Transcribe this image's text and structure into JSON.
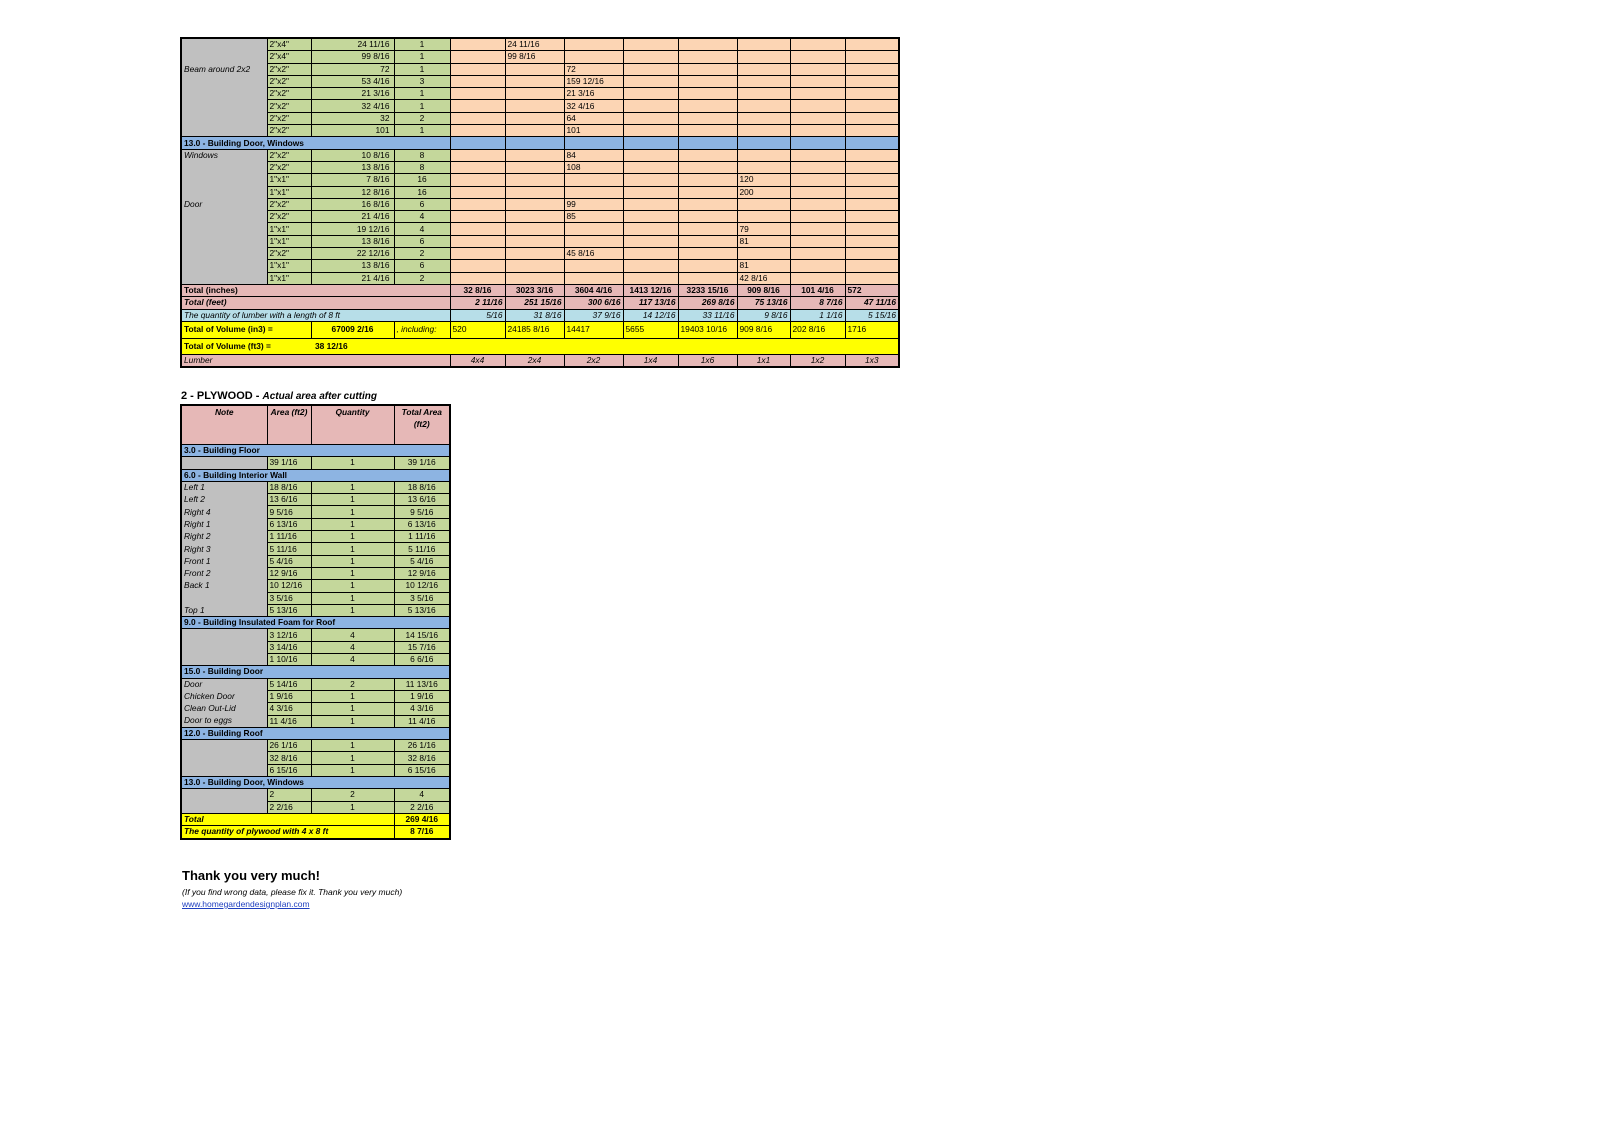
{
  "lumber": {
    "rows": [
      {
        "type": "item",
        "note": "",
        "size": "2\"x4\"",
        "len": "24 11/16",
        "qty": "1",
        "cols": [
          "",
          "24 11/16",
          "",
          "",
          "",
          "",
          "",
          ""
        ]
      },
      {
        "type": "item",
        "note": "",
        "size": "2\"x4\"",
        "len": "99  8/16",
        "qty": "1",
        "cols": [
          "",
          "99  8/16",
          "",
          "",
          "",
          "",
          "",
          ""
        ]
      },
      {
        "type": "item",
        "note": "Beam around 2x2",
        "size": "2\"x2\"",
        "len": "72",
        "qty": "1",
        "cols": [
          "",
          "",
          "72",
          "",
          "",
          "",
          "",
          ""
        ]
      },
      {
        "type": "item",
        "note": "",
        "size": "2\"x2\"",
        "len": "53  4/16",
        "qty": "3",
        "cols": [
          "",
          "",
          "159 12/16",
          "",
          "",
          "",
          "",
          ""
        ]
      },
      {
        "type": "item",
        "note": "",
        "size": "2\"x2\"",
        "len": "21  3/16",
        "qty": "1",
        "cols": [
          "",
          "",
          "21  3/16",
          "",
          "",
          "",
          "",
          ""
        ]
      },
      {
        "type": "item",
        "note": "",
        "size": "2\"x2\"",
        "len": "32  4/16",
        "qty": "1",
        "cols": [
          "",
          "",
          "32  4/16",
          "",
          "",
          "",
          "",
          ""
        ]
      },
      {
        "type": "item",
        "note": "",
        "size": "2\"x2\"",
        "len": "32",
        "qty": "2",
        "cols": [
          "",
          "",
          "64",
          "",
          "",
          "",
          "",
          ""
        ]
      },
      {
        "type": "item",
        "note": "",
        "size": "2\"x2\"",
        "len": "101",
        "qty": "1",
        "cols": [
          "",
          "",
          "101",
          "",
          "",
          "",
          "",
          ""
        ]
      },
      {
        "type": "section",
        "label": "13.0 - Building Door, Windows"
      },
      {
        "type": "item",
        "note": "Windows",
        "size": "2\"x2\"",
        "len": "10  8/16",
        "qty": "8",
        "cols": [
          "",
          "",
          "84",
          "",
          "",
          "",
          "",
          ""
        ]
      },
      {
        "type": "item",
        "note": "",
        "size": "2\"x2\"",
        "len": "13  8/16",
        "qty": "8",
        "cols": [
          "",
          "",
          "108",
          "",
          "",
          "",
          "",
          ""
        ]
      },
      {
        "type": "item",
        "note": "",
        "size": "1\"x1\"",
        "len": "7  8/16",
        "qty": "16",
        "cols": [
          "",
          "",
          "",
          "",
          "",
          "120",
          "",
          ""
        ]
      },
      {
        "type": "item",
        "note": "",
        "size": "1\"x1\"",
        "len": "12  8/16",
        "qty": "16",
        "cols": [
          "",
          "",
          "",
          "",
          "",
          "200",
          "",
          ""
        ]
      },
      {
        "type": "item",
        "note": "Door",
        "size": "2\"x2\"",
        "len": "16  8/16",
        "qty": "6",
        "cols": [
          "",
          "",
          "99",
          "",
          "",
          "",
          "",
          ""
        ]
      },
      {
        "type": "item",
        "note": "",
        "size": "2\"x2\"",
        "len": "21  4/16",
        "qty": "4",
        "cols": [
          "",
          "",
          "85",
          "",
          "",
          "",
          "",
          ""
        ]
      },
      {
        "type": "item",
        "note": "",
        "size": "1\"x1\"",
        "len": "19 12/16",
        "qty": "4",
        "cols": [
          "",
          "",
          "",
          "",
          "",
          "79",
          "",
          ""
        ]
      },
      {
        "type": "item",
        "note": "",
        "size": "1\"x1\"",
        "len": "13  8/16",
        "qty": "6",
        "cols": [
          "",
          "",
          "",
          "",
          "",
          "81",
          "",
          ""
        ]
      },
      {
        "type": "item",
        "note": "",
        "size": "2\"x2\"",
        "len": "22 12/16",
        "qty": "2",
        "cols": [
          "",
          "",
          "45  8/16",
          "",
          "",
          "",
          "",
          ""
        ]
      },
      {
        "type": "item",
        "note": "",
        "size": "1\"x1\"",
        "len": "13  8/16",
        "qty": "6",
        "cols": [
          "",
          "",
          "",
          "",
          "",
          "81",
          "",
          ""
        ]
      },
      {
        "type": "item",
        "note": "",
        "size": "1\"x1\"",
        "len": "21  4/16",
        "qty": "2",
        "cols": [
          "",
          "",
          "",
          "",
          "",
          "42  8/16",
          "",
          ""
        ]
      }
    ],
    "total_inches": {
      "label": "Total (inches)",
      "values": [
        "32  8/16",
        "3023  3/16",
        "3604  4/16",
        "1413 12/16",
        "3233 15/16",
        "909  8/16",
        "101  4/16",
        "572"
      ]
    },
    "total_feet": {
      "label": "Total (feet)",
      "values": [
        "2 11/16",
        "251 15/16",
        "300  6/16",
        "117 13/16",
        "269  8/16",
        "75 13/16",
        "8  7/16",
        "47 11/16"
      ]
    },
    "qty_8ft": {
      "label": "The quantity of lumber with a length of 8 ft",
      "values": [
        "5/16",
        "31  8/16",
        "37  9/16",
        "14 12/16",
        "33 11/16",
        "9  8/16",
        "1  1/16",
        "5 15/16"
      ]
    },
    "volume_in3": {
      "label": "Total of Volume (in3) =",
      "value": "67009  2/16",
      "including": ", including:",
      "values": [
        "520",
        "24185  8/16",
        "14417",
        "5655",
        "19403 10/16",
        "909  8/16",
        "202  8/16",
        "1716"
      ]
    },
    "volume_ft3": {
      "label": "Total of Volume (ft3) =",
      "value": "38 12/16"
    },
    "lumber_row": {
      "label": "Lumber",
      "values": [
        "4x4",
        "2x4",
        "2x2",
        "1x4",
        "1x6",
        "1x1",
        "1x2",
        "1x3"
      ]
    }
  },
  "plywood": {
    "title": "2 - PLYWOOD -",
    "subtitle": "Actual area after cutting",
    "headers": {
      "note": "Note",
      "area": "Area (ft2)",
      "quantity": "Quantity",
      "total": "Total Area (ft2)"
    },
    "rows": [
      {
        "type": "section",
        "label": "3.0 - Building Floor"
      },
      {
        "type": "item",
        "note": "",
        "area": "39  1/16",
        "qty": "1",
        "total": "39  1/16"
      },
      {
        "type": "section",
        "label": "6.0 - Building Interior Wall"
      },
      {
        "type": "item",
        "note": "Left 1",
        "area": "18  8/16",
        "qty": "1",
        "total": "18  8/16"
      },
      {
        "type": "item",
        "note": "Left 2",
        "area": "13  6/16",
        "qty": "1",
        "total": "13  6/16"
      },
      {
        "type": "item",
        "note": "Right 4",
        "area": "9  5/16",
        "qty": "1",
        "total": "9  5/16"
      },
      {
        "type": "item",
        "note": "Right 1",
        "area": "6 13/16",
        "qty": "1",
        "total": "6 13/16"
      },
      {
        "type": "item",
        "note": "Right 2",
        "area": "1 11/16",
        "qty": "1",
        "total": "1 11/16"
      },
      {
        "type": "item",
        "note": "Right 3",
        "area": "5 11/16",
        "qty": "1",
        "total": "5 11/16"
      },
      {
        "type": "item",
        "note": "Front 1",
        "area": "5  4/16",
        "qty": "1",
        "total": "5  4/16"
      },
      {
        "type": "item",
        "note": "Front 2",
        "area": "12  9/16",
        "qty": "1",
        "total": "12  9/16"
      },
      {
        "type": "item",
        "note": "Back 1",
        "area": "10 12/16",
        "qty": "1",
        "total": "10 12/16"
      },
      {
        "type": "item",
        "note": "",
        "area": "3  5/16",
        "qty": "1",
        "total": "3  5/16"
      },
      {
        "type": "item",
        "note": "Top 1",
        "area": "5 13/16",
        "qty": "1",
        "total": "5 13/16"
      },
      {
        "type": "section",
        "label": "9.0 - Building Insulated Foam for Roof"
      },
      {
        "type": "item",
        "note": "",
        "area": "3 12/16",
        "qty": "4",
        "total": "14 15/16"
      },
      {
        "type": "item",
        "note": "",
        "area": "3 14/16",
        "qty": "4",
        "total": "15  7/16"
      },
      {
        "type": "item",
        "note": "",
        "area": "1 10/16",
        "qty": "4",
        "total": "6  6/16"
      },
      {
        "type": "section",
        "label": "15.0 - Building Door"
      },
      {
        "type": "item",
        "note": "Door",
        "area": "5 14/16",
        "qty": "2",
        "total": "11 13/16"
      },
      {
        "type": "item",
        "note": "Chicken Door",
        "area": "1  9/16",
        "qty": "1",
        "total": "1  9/16"
      },
      {
        "type": "item",
        "note": "Clean Out-Lid",
        "area": "4  3/16",
        "qty": "1",
        "total": "4  3/16"
      },
      {
        "type": "item",
        "note": "Door to eggs",
        "area": "11  4/16",
        "qty": "1",
        "total": "11  4/16"
      },
      {
        "type": "section",
        "label": "12.0 - Building Roof"
      },
      {
        "type": "item",
        "note": "",
        "area": "26  1/16",
        "qty": "1",
        "total": "26  1/16"
      },
      {
        "type": "item",
        "note": "",
        "area": "32  8/16",
        "qty": "1",
        "total": "32  8/16"
      },
      {
        "type": "item",
        "note": "",
        "area": "6 15/16",
        "qty": "1",
        "total": "6 15/16"
      },
      {
        "type": "section",
        "label": "13.0 - Building Door, Windows"
      },
      {
        "type": "item",
        "note": "",
        "area": "2",
        "qty": "2",
        "total": "4"
      },
      {
        "type": "item",
        "note": "",
        "area": "2  2/16",
        "qty": "1",
        "total": "2  2/16"
      }
    ],
    "total": {
      "label": "Total",
      "value": "269  4/16"
    },
    "qty_sheets": {
      "label": "The quantity of plywood with 4 x 8 ft",
      "value": "8  7/16"
    }
  },
  "footer": {
    "thanks": "Thank you very much!",
    "note": "(If you find wrong data, please fix it. Thank you very much)",
    "link": "www.homegardendesignplan.com"
  }
}
